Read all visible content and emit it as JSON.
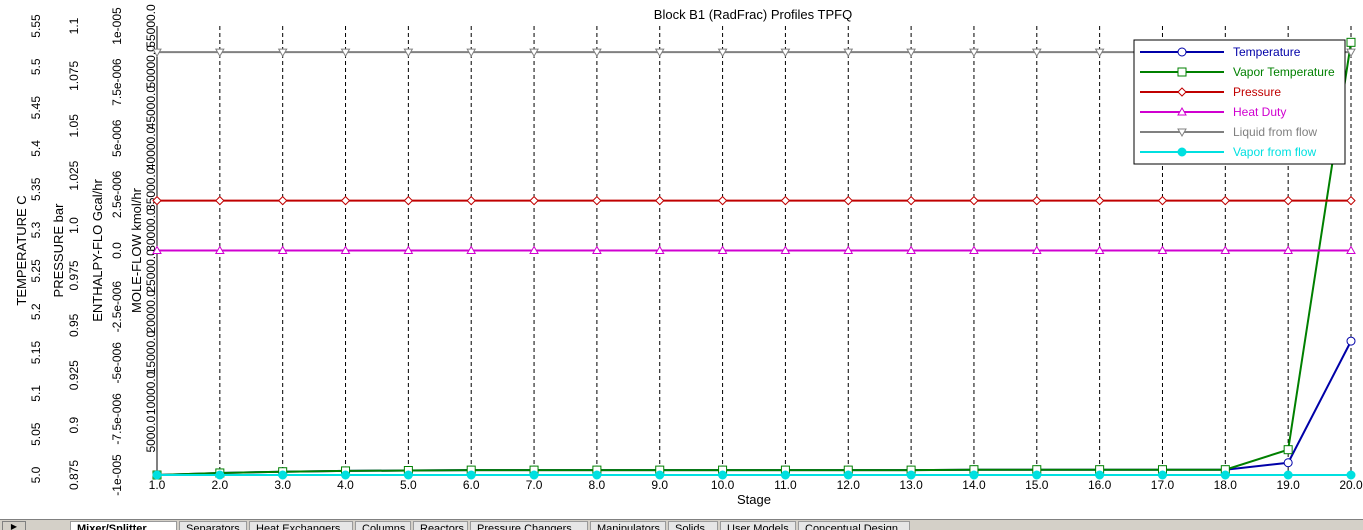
{
  "chart_data": {
    "type": "line",
    "title": "Block B1 (RadFrac) Profiles TPFQ",
    "xlabel": "Stage",
    "x": [
      1,
      2,
      3,
      4,
      5,
      6,
      7,
      8,
      9,
      10,
      11,
      12,
      13,
      14,
      15,
      16,
      17,
      18,
      19,
      20
    ],
    "x_ticks": [
      "1.0",
      "2.0",
      "3.0",
      "4.0",
      "5.0",
      "6.0",
      "7.0",
      "8.0",
      "9.0",
      "10.0",
      "11.0",
      "12.0",
      "13.0",
      "14.0",
      "15.0",
      "16.0",
      "17.0",
      "18.0",
      "19.0",
      "20.0"
    ],
    "xlim": [
      1,
      20
    ],
    "grid": "vertical dashed",
    "legend_position": "top-right",
    "axes": [
      {
        "id": "temperature",
        "label": "TEMPERATURE C",
        "ylim": [
          5.0,
          5.55
        ],
        "ticks": [
          "5.0",
          "5.05",
          "5.1",
          "5.15",
          "5.2",
          "5.25",
          "5.3",
          "5.35",
          "5.4",
          "5.45",
          "5.5",
          "5.55"
        ]
      },
      {
        "id": "pressure",
        "label": "PRESSURE bar",
        "ylim": [
          0.875,
          1.1
        ],
        "ticks": [
          "0.875",
          "0.9",
          "0.925",
          "0.95",
          "0.975",
          "1.0",
          "1.025",
          "1.05",
          "1.075",
          "1.1"
        ]
      },
      {
        "id": "enthalpy",
        "label": "ENTHALPY-FLO Gcal/hr",
        "ylim": [
          -1e-05,
          1e-05
        ],
        "ticks": [
          "-1e-005",
          "-7.5e-006",
          "-5e-006",
          "-2.5e-006",
          "0.0",
          "2.5e-006",
          "5e-006",
          "7.5e-006",
          "1e-005"
        ]
      },
      {
        "id": "moleflow",
        "label": "MOLE-FLOW kmol/hr",
        "ylim": [
          0,
          55000
        ],
        "ticks": [
          "5000.0",
          "10000.0",
          "15000.0",
          "20000.0",
          "25000.0",
          "30000.0",
          "35000.0",
          "40000.0",
          "45000.0",
          "50000.0",
          "55000.0"
        ]
      }
    ],
    "series": [
      {
        "name": "Temperature",
        "axis": "temperature",
        "color": "#0000a8",
        "marker": "circle",
        "values": [
          5.0,
          5.0025,
          5.004,
          5.005,
          5.0055,
          5.006,
          5.006,
          5.006,
          5.006,
          5.006,
          5.006,
          5.006,
          5.006,
          5.0065,
          5.0065,
          5.0065,
          5.0065,
          5.0065,
          5.015,
          5.164
        ]
      },
      {
        "name": "Vapor Temperature",
        "axis": "temperature",
        "color": "#008000",
        "marker": "square",
        "values": [
          5.0,
          5.0025,
          5.004,
          5.005,
          5.0055,
          5.006,
          5.006,
          5.006,
          5.006,
          5.006,
          5.006,
          5.006,
          5.006,
          5.0065,
          5.0065,
          5.0065,
          5.0065,
          5.0065,
          5.031,
          5.53
        ]
      },
      {
        "name": "Pressure",
        "axis": "pressure",
        "color": "#c00000",
        "marker": "diamond",
        "values": [
          1.0125,
          1.0125,
          1.0125,
          1.0125,
          1.0125,
          1.0125,
          1.0125,
          1.0125,
          1.0125,
          1.0125,
          1.0125,
          1.0125,
          1.0125,
          1.0125,
          1.0125,
          1.0125,
          1.0125,
          1.0125,
          1.0125,
          1.0125
        ]
      },
      {
        "name": "Heat Duty",
        "axis": "enthalpy",
        "color": "#d000d0",
        "marker": "triangle-up",
        "values": [
          0,
          0,
          0,
          0,
          0,
          0,
          0,
          0,
          0,
          0,
          0,
          0,
          0,
          0,
          0,
          0,
          0,
          0,
          0,
          0
        ]
      },
      {
        "name": "Liquid from flow",
        "axis": "moleflow",
        "color": "#808080",
        "marker": "triangle-down",
        "values": [
          51800,
          51800,
          51800,
          51800,
          51800,
          51800,
          51800,
          51800,
          51800,
          51800,
          51800,
          51800,
          51800,
          51800,
          51800,
          51800,
          51800,
          51800,
          51800,
          51800
        ]
      },
      {
        "name": "Vapor from flow",
        "axis": "moleflow",
        "color": "#00e0e0",
        "marker": "filled-circle",
        "values": [
          0,
          0,
          0,
          0,
          0,
          0,
          0,
          0,
          0,
          0,
          0,
          0,
          0,
          0,
          0,
          0,
          0,
          0,
          0,
          0
        ]
      }
    ]
  },
  "tabs": [
    "Mixer/Splitter",
    "Separators",
    "Heat Exchangers",
    "Columns",
    "Reactors",
    "Pressure Changers",
    "Manipulators",
    "Solids",
    "User Models",
    "Conceptual Design"
  ]
}
